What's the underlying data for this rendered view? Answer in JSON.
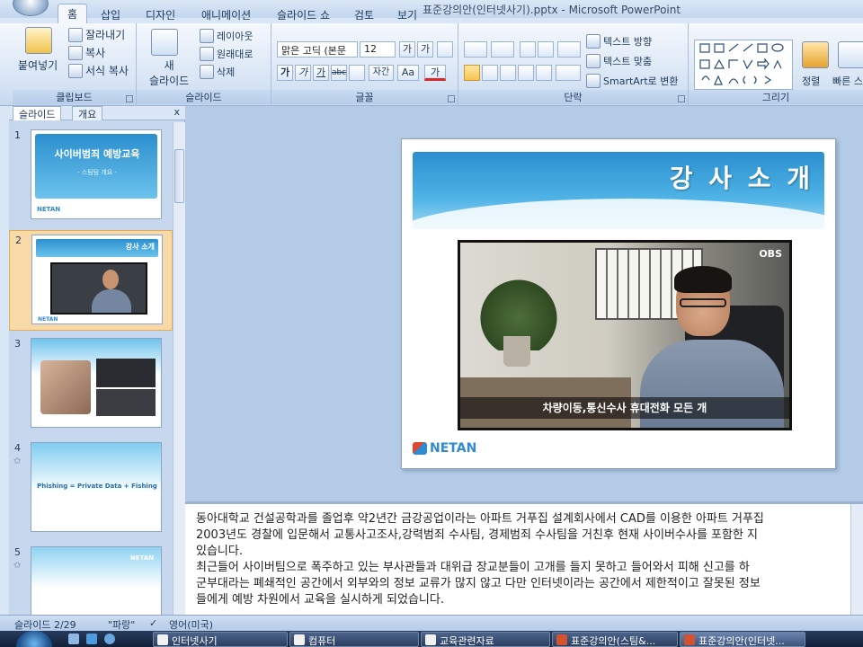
{
  "window": {
    "title": "표준강의안(인터넷사기).pptx - Microsoft PowerPoint"
  },
  "ribbon": {
    "tabs": [
      "홈",
      "삽입",
      "디자인",
      "애니메이션",
      "슬라이드 쇼",
      "검토",
      "보기"
    ],
    "active_tab": "홈",
    "clipboard": {
      "title": "클립보드",
      "paste": "붙여넣기",
      "cut": "잘라내기",
      "copy": "복사",
      "format_painter": "서식 복사"
    },
    "slides": {
      "title": "슬라이드",
      "new_slide": "새\n슬라이드",
      "new_slide_top": "새",
      "new_slide_bottom": "슬라이드",
      "layout": "레이아웃",
      "reset": "원래대로",
      "delete": "삭제"
    },
    "font": {
      "title": "글꼴",
      "font_name": "맑은 고딕 (본문",
      "font_size": "12",
      "bold": "가",
      "italic": "가",
      "underline": "가",
      "strike": "abc",
      "spacing": "자간",
      "case": "Aa",
      "color": "가"
    },
    "paragraph": {
      "title": "단락",
      "text_direction": "텍스트 방향",
      "align_text": "텍스트 맞춤",
      "smartart": "SmartArt로 변환"
    },
    "drawing": {
      "title": "그리기",
      "arrange": "정렬",
      "quick_styles": "빠른 스타일"
    }
  },
  "left_panel": {
    "tabs": [
      "슬라이드",
      "개요"
    ],
    "close": "x",
    "thumbnails": [
      {
        "number": "1",
        "title": "사이버범죄 예방교육",
        "subtitle": "- 스팀팀 개요 -",
        "logo": "NETAN"
      },
      {
        "number": "2",
        "title": "강사 소개",
        "logo": "NETAN"
      },
      {
        "number": "3"
      },
      {
        "number": "4",
        "title": "Phishing = Private Data + Fishing"
      },
      {
        "number": "5",
        "title": "NETAN"
      }
    ]
  },
  "slide": {
    "title": "강 사 소 개",
    "video_caption": "차량이동,통신수사 휴대전화 모든 개",
    "channel": "OBS",
    "logo": "NETAN"
  },
  "notes": {
    "lines": [
      "동아대학교 건설공학과를 졸업후 약2년간 금강공업이라는 아파트 거푸집 설계회사에서 CAD를 이용한 아파트 거푸집",
      "2003년도 경찰에 입문해서 교통사고조사,강력범죄 수사팀, 경제범죄 수사팀을 거친후 현재 사이버수사를 포함한 지",
      "있습니다.",
      "최근들어 사이버팀으로 폭주하고 있는 부사관들과  대위급 장교분들이 고개를 들지 못하고 들어와서 피해 신고를 하",
      "군부대라는 폐쇄적인 공간에서 외부와의 정보 교류가 많지 않고 다만 인터넷이라는 공간에서 제한적이고 잘못된 정보",
      "들에게 예방 차원에서 교육을 실시하게 되었습니다."
    ]
  },
  "status_bar": {
    "slide_counter": "슬라이드 2/29",
    "theme": "\"파랑\"",
    "language": "영어(미국)"
  },
  "taskbar": {
    "items": [
      {
        "label": "인터넷사기",
        "active": false
      },
      {
        "label": "컴퓨터",
        "active": false
      },
      {
        "label": "교육관련자료",
        "active": false
      },
      {
        "label": "표준강의안(스팀&...",
        "active": false
      },
      {
        "label": "표준강의안(인터넷...",
        "active": true
      }
    ]
  },
  "colors": {
    "accent": "#2e8ad1",
    "slide_band": "#4fb3e6",
    "selection": "#f8d9a8"
  }
}
